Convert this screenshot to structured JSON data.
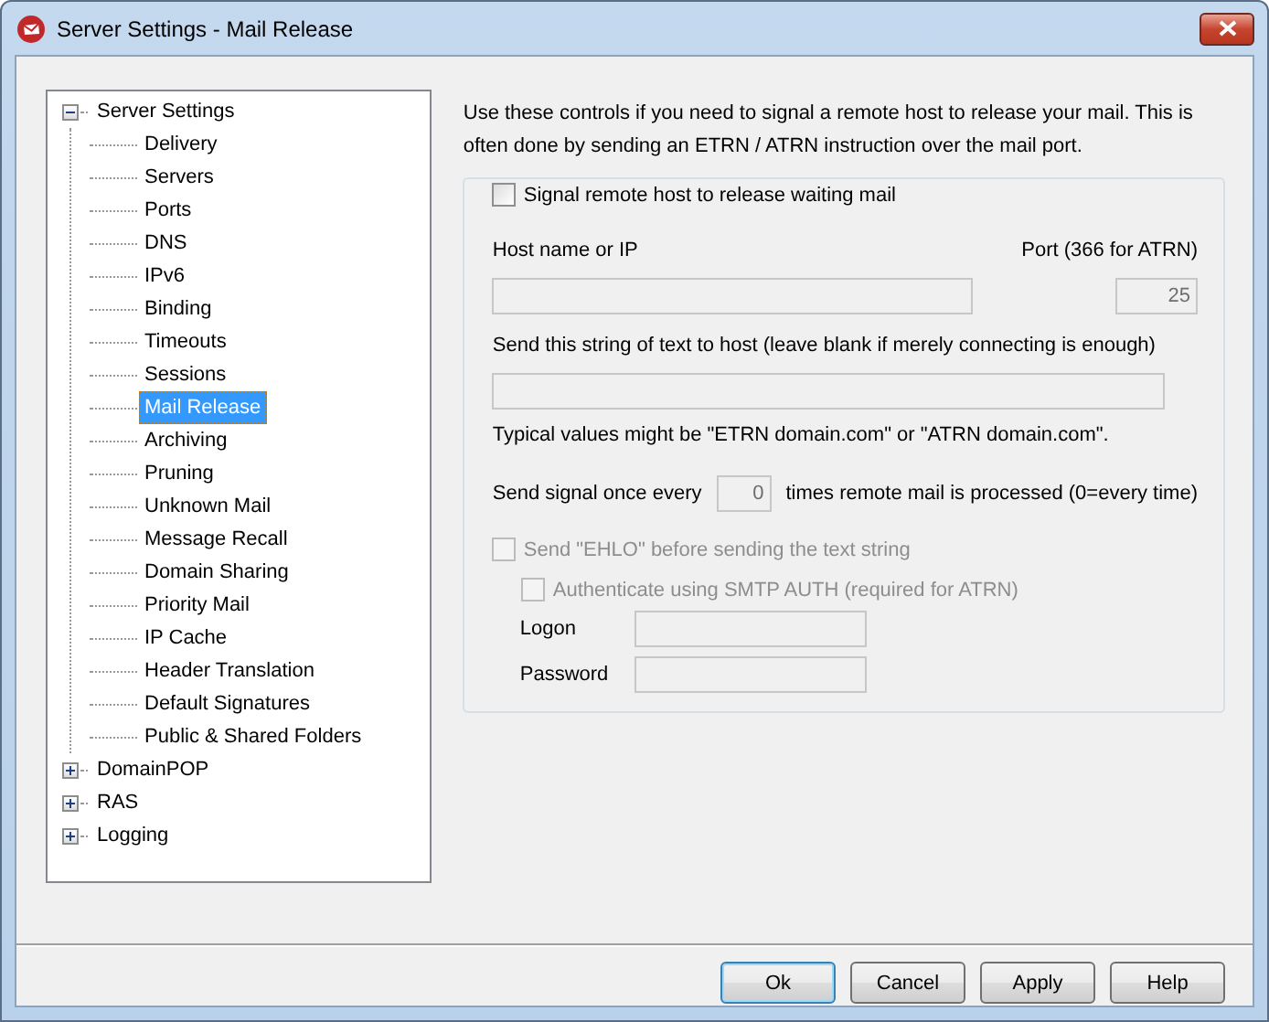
{
  "window": {
    "title": "Server Settings - Mail Release"
  },
  "tree": [
    {
      "label": "Server Settings",
      "expanded": true,
      "selected": false,
      "children": [
        {
          "label": "Delivery",
          "selected": false
        },
        {
          "label": "Servers",
          "selected": false
        },
        {
          "label": "Ports",
          "selected": false
        },
        {
          "label": "DNS",
          "selected": false
        },
        {
          "label": "IPv6",
          "selected": false
        },
        {
          "label": "Binding",
          "selected": false
        },
        {
          "label": "Timeouts",
          "selected": false
        },
        {
          "label": "Sessions",
          "selected": false
        },
        {
          "label": "Mail Release",
          "selected": true
        },
        {
          "label": "Archiving",
          "selected": false
        },
        {
          "label": "Pruning",
          "selected": false
        },
        {
          "label": "Unknown Mail",
          "selected": false
        },
        {
          "label": "Message Recall",
          "selected": false
        },
        {
          "label": "Domain Sharing",
          "selected": false
        },
        {
          "label": "Priority Mail",
          "selected": false
        },
        {
          "label": "IP Cache",
          "selected": false
        },
        {
          "label": "Header Translation",
          "selected": false
        },
        {
          "label": "Default Signatures",
          "selected": false
        },
        {
          "label": "Public & Shared Folders",
          "selected": false
        }
      ]
    },
    {
      "label": "DomainPOP",
      "expanded": false,
      "selected": false
    },
    {
      "label": "RAS",
      "expanded": false,
      "selected": false
    },
    {
      "label": "Logging",
      "expanded": false,
      "selected": false
    }
  ],
  "intro": "Use these controls if you need to signal a remote host to release your mail.  This is often done by sending an ETRN / ATRN instruction over the mail port.",
  "group": {
    "label": "Signal remote host to release waiting mail",
    "checked": false
  },
  "host": {
    "label": "Host name or IP",
    "disabled": true
  },
  "port": {
    "label": "Port (366 for ATRN)",
    "value": "25",
    "disabled": true
  },
  "text_string": {
    "label": "Send this string of text to host (leave blank if merely connecting is enough)",
    "disabled": true
  },
  "typical": "Typical values might be \"ETRN domain.com\" or \"ATRN domain.com\".",
  "every": {
    "before": "Send signal once every",
    "value": "0",
    "after": "times remote mail is processed (0=every time)",
    "disabled": true
  },
  "ehlo": {
    "label": "Send \"EHLO\" before sending the text string",
    "checked": false,
    "disabled": true
  },
  "auth": {
    "label": "Authenticate using SMTP AUTH (required for ATRN)",
    "checked": false,
    "disabled": true
  },
  "logon": {
    "label": "Logon",
    "disabled": true
  },
  "password": {
    "label": "Password",
    "disabled": true
  },
  "buttons": [
    {
      "label": "Ok",
      "default": true
    },
    {
      "label": "Cancel",
      "default": false
    },
    {
      "label": "Apply",
      "default": false
    },
    {
      "label": "Help",
      "default": false
    }
  ]
}
